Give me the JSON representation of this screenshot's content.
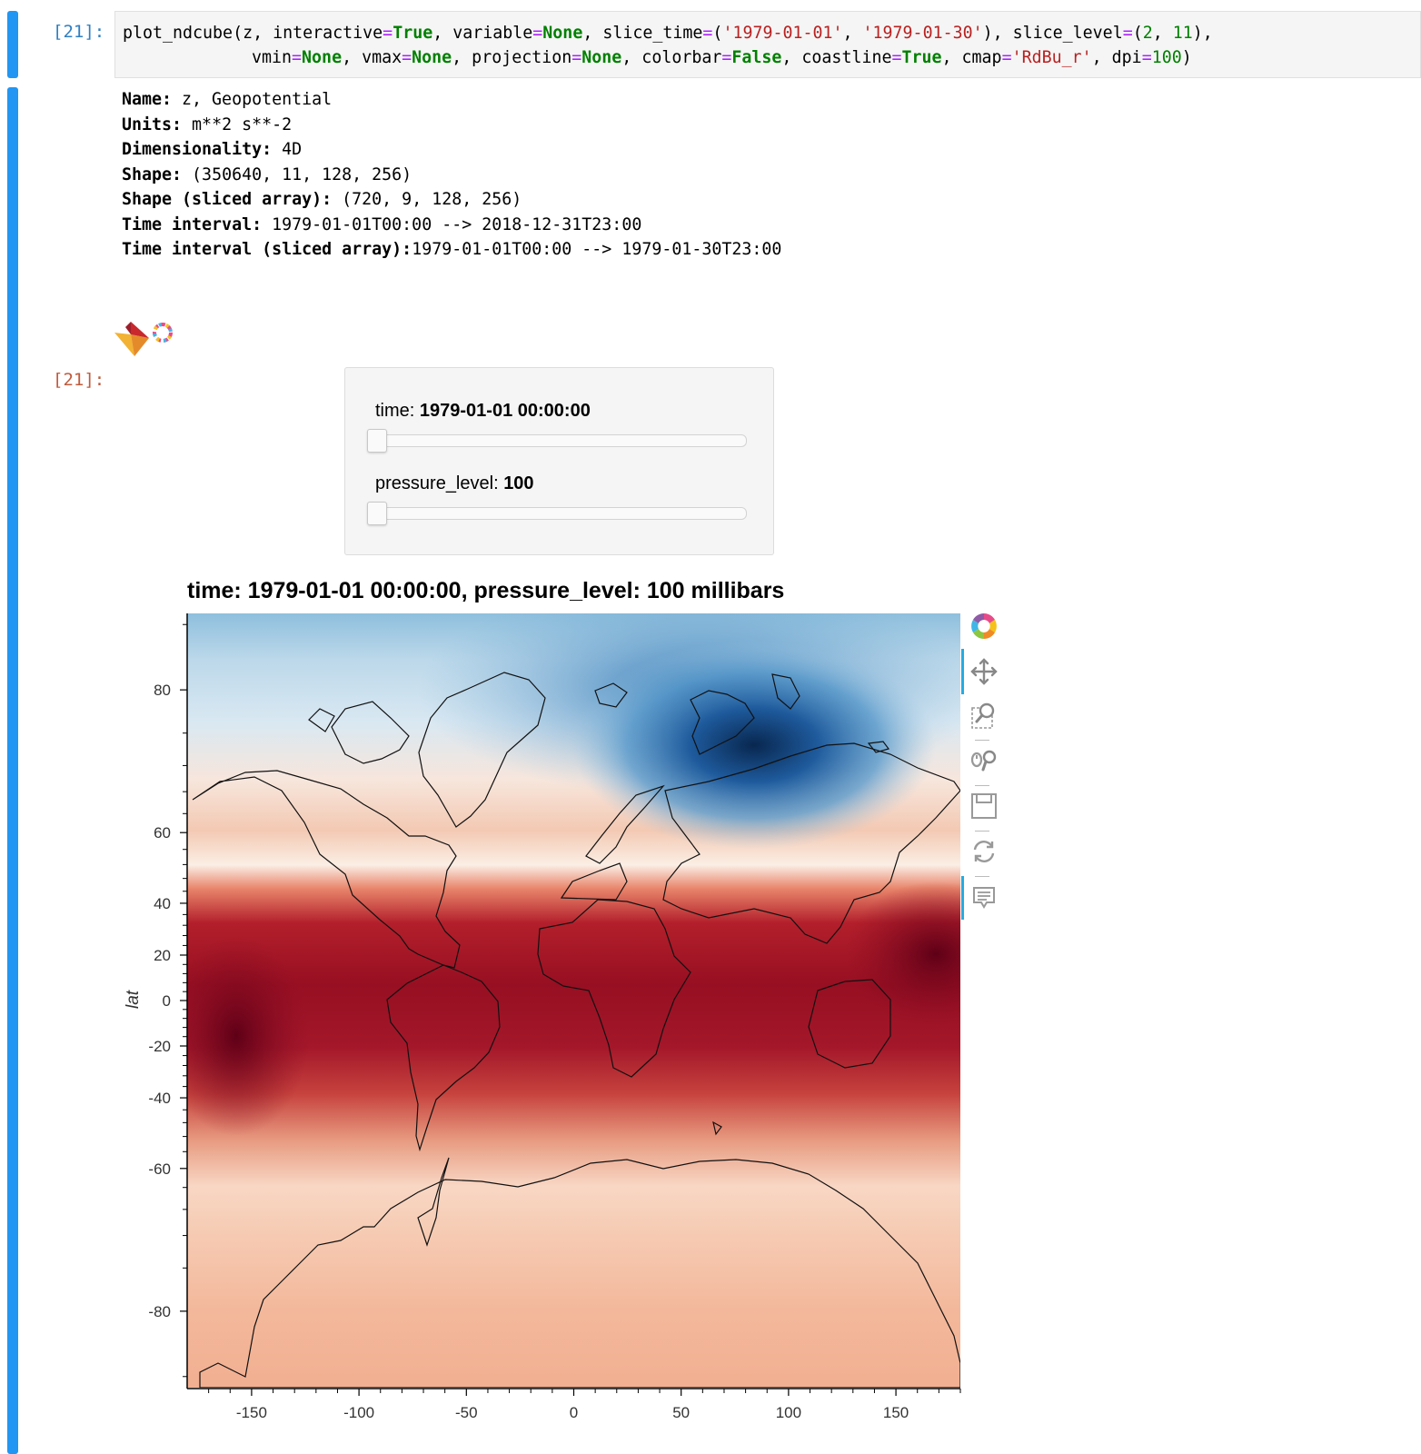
{
  "input_cell": {
    "prompt": "[21]:",
    "code_line_1": [
      {
        "t": "plot_ndcube(z, interactive",
        "c": ""
      },
      {
        "t": "=",
        "c": "op"
      },
      {
        "t": "True",
        "c": "kw"
      },
      {
        "t": ", variable",
        "c": ""
      },
      {
        "t": "=",
        "c": "op"
      },
      {
        "t": "None",
        "c": "kw"
      },
      {
        "t": ", slice_time",
        "c": ""
      },
      {
        "t": "=",
        "c": "op"
      },
      {
        "t": "(",
        "c": ""
      },
      {
        "t": "'1979-01-01'",
        "c": "str"
      },
      {
        "t": ", ",
        "c": ""
      },
      {
        "t": "'1979-01-30'",
        "c": "str"
      },
      {
        "t": "), slice_level",
        "c": ""
      },
      {
        "t": "=",
        "c": "op"
      },
      {
        "t": "(",
        "c": ""
      },
      {
        "t": "2",
        "c": "num"
      },
      {
        "t": ", ",
        "c": ""
      },
      {
        "t": "11",
        "c": "num"
      },
      {
        "t": "),",
        "c": ""
      }
    ],
    "code_line_2": [
      {
        "t": "vmin",
        "c": ""
      },
      {
        "t": "=",
        "c": "op"
      },
      {
        "t": "None",
        "c": "kw"
      },
      {
        "t": ", vmax",
        "c": ""
      },
      {
        "t": "=",
        "c": "op"
      },
      {
        "t": "None",
        "c": "kw"
      },
      {
        "t": ", projection",
        "c": ""
      },
      {
        "t": "=",
        "c": "op"
      },
      {
        "t": "None",
        "c": "kw"
      },
      {
        "t": ", colorbar",
        "c": ""
      },
      {
        "t": "=",
        "c": "op"
      },
      {
        "t": "False",
        "c": "kw"
      },
      {
        "t": ", coastline",
        "c": ""
      },
      {
        "t": "=",
        "c": "op"
      },
      {
        "t": "True",
        "c": "kw"
      },
      {
        "t": ", cmap",
        "c": ""
      },
      {
        "t": "=",
        "c": "op"
      },
      {
        "t": "'RdBu_r'",
        "c": "str"
      },
      {
        "t": ", dpi",
        "c": ""
      },
      {
        "t": "=",
        "c": "op"
      },
      {
        "t": "100",
        "c": "num"
      },
      {
        "t": ")",
        "c": ""
      }
    ]
  },
  "output_cell": {
    "prompt": "[21]:",
    "info": [
      {
        "key": "Name:",
        "value": " z, Geopotential"
      },
      {
        "key": "Units:",
        "value": " m**2 s**-2"
      },
      {
        "key": "Dimensionality:",
        "value": " 4D"
      },
      {
        "key": "Shape:",
        "value": " (350640, 11, 128, 256)"
      },
      {
        "key": "Shape (sliced array):",
        "value": " (720, 9, 128, 256)"
      },
      {
        "key": "Time interval:",
        "value": " 1979-01-01T00:00 --> 2018-12-31T23:00"
      },
      {
        "key": "Time interval (sliced array):",
        "value": "1979-01-01T00:00 --> 1979-01-30T23:00"
      }
    ]
  },
  "widgets": {
    "time": {
      "name": "time: ",
      "value": "1979-01-01 00:00:00",
      "position": 0.0
    },
    "pressure_level": {
      "name": "pressure_level: ",
      "value": "100",
      "position": 0.0
    }
  },
  "toolbar": {
    "tools": [
      "bokeh-logo-icon",
      "pan-icon",
      "box-zoom-icon",
      "wheel-zoom-icon",
      "save-icon",
      "reset-icon",
      "hover-icon"
    ],
    "active": [
      "pan-icon",
      "hover-icon"
    ]
  },
  "chart_data": {
    "type": "heatmap",
    "title": "time: 1979-01-01 00:00:00, pressure_level: 100 millibars",
    "xlabel": "",
    "ylabel": "lat",
    "xlim": [
      -180,
      180
    ],
    "ylim": [
      -90,
      90
    ],
    "y_scale": "mercator",
    "x_ticks": [
      -150,
      -100,
      -50,
      0,
      50,
      100,
      150
    ],
    "y_ticks": [
      80,
      60,
      40,
      20,
      0,
      -20,
      -40,
      -60,
      -80
    ],
    "colormap": "RdBu_r",
    "coastline": true,
    "colorbar": false,
    "colors": {
      "deep_blue": "#0b2f5c",
      "mid_blue": "#2f7ab9",
      "light_blue": "#d3e6f2",
      "white": "#f7f2ee",
      "light_red": "#f6c2a8",
      "mid_red": "#d85a4a",
      "deep_red": "#7f0b1e"
    }
  }
}
